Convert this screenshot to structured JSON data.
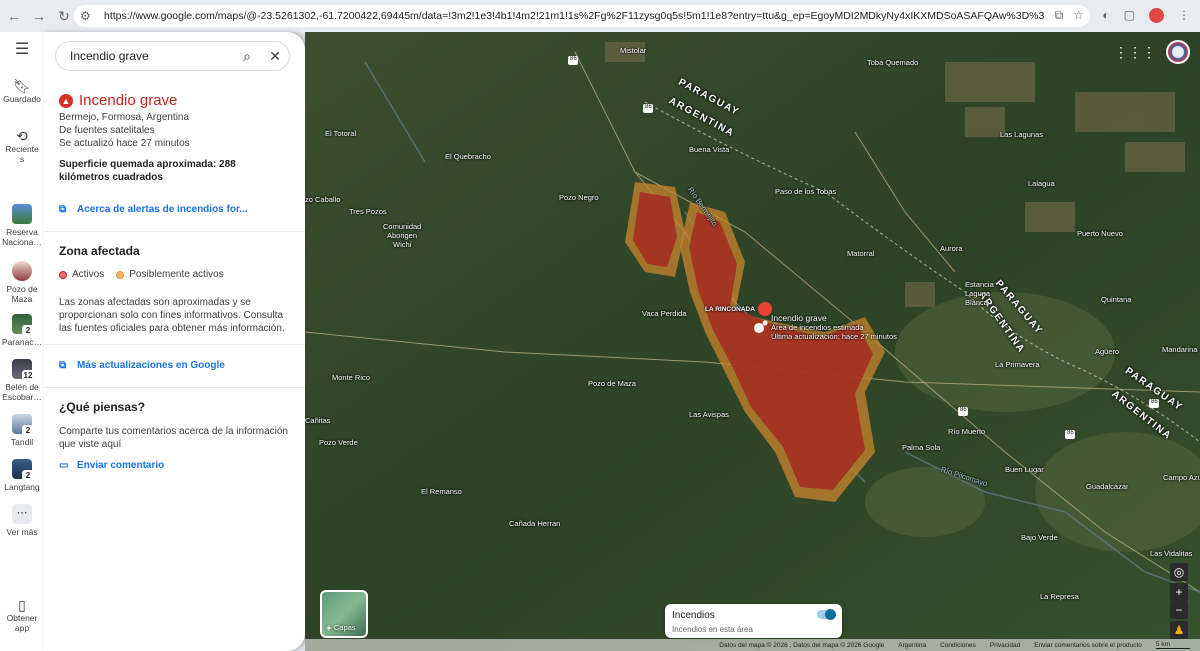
{
  "browser": {
    "url": "https://www.google.com/maps/@-23.5261302,-61.7200422,69445m/data=!3m2!1e3!4b1!4m2!21m1!1s%2Fg%2F11zysg0q5s!5m1!1e8?entry=ttu&g_ep=EgoyMDI2MDkyNy4xIKXMDSoASAFQAw%3D%3D",
    "nav_icons": [
      "back-icon",
      "forward-icon",
      "reload-icon",
      "site-settings-icon"
    ]
  },
  "rail": {
    "menu_icon": "hamburger-icon",
    "saved_label": "Guardado",
    "recent_label_1": "Reciente",
    "recent_label_2": "s",
    "items": [
      {
        "line1": "Reserva",
        "line2": "Naciona…",
        "badge": ""
      },
      {
        "line1": "Pozo de",
        "line2": "Maza",
        "badge": ""
      },
      {
        "line1": "Paranac…",
        "line2": "",
        "badge": "2"
      },
      {
        "line1": "Belén de",
        "line2": "Escobar…",
        "badge": "12"
      },
      {
        "line1": "Tandil",
        "line2": "",
        "badge": "2"
      },
      {
        "line1": "Langtang",
        "line2": "",
        "badge": "2"
      }
    ],
    "more_label": "Ver más",
    "get_app_1": "Obtener",
    "get_app_2": "app"
  },
  "panel": {
    "search_value": "Incendio grave",
    "title": "Incendio grave",
    "location": "Bermejo, Formosa, Argentina",
    "source": "De fuentes satelitales",
    "updated": "Se actualizó hace 27 minutos",
    "area_text": "Superficie quemada aproximada: 288 kilómetros cuadrados",
    "alerts_link": "Acerca de alertas de incendios for...",
    "zone_title": "Zona afectada",
    "legend_active": "Activos",
    "legend_possible": "Posiblemente activos",
    "disclaimer": "Las zonas afectadas son aproximadas y se proporcionan solo con fines informativos. Consulta las fuentes oficiales para obtener más información.",
    "more_updates_link": "Más actualizaciones en Google",
    "feedback_title": "¿Qué piensas?",
    "feedback_text": "Comparte tus comentarios acerca de la información que viste aquí",
    "feedback_link": "Enviar comentario"
  },
  "colors": {
    "fire_red": "#d93025",
    "active_dot": "#e57373",
    "possible_dot": "#f0b400",
    "link_blue": "#1a73e8"
  },
  "map": {
    "labels": {
      "mistolar": "Mistolar",
      "toba_quemado": "Toba Quemado",
      "las_lagunas": "Las Lagunas",
      "el_totoral": "El Totoral",
      "el_quebracho": "El Quebracho",
      "buena_vista": "Buena Vista",
      "lalagua": "Lalagua",
      "paso_de_los_tobas": "Paso de los Tobas",
      "pozo_negro": "Pozo Negro",
      "pozo_caballo": "zo Caballo",
      "tres_pozos": "Tres Pozos",
      "comunidad_1": "Comunidad",
      "comunidad_2": "Aborigen",
      "comunidad_3": "Wichi",
      "matorral": "Matorral",
      "aurora": "Aurora",
      "puerto_nuevo": "Puerto Nuevo",
      "estancia_1": "Estancia",
      "estancia_2": "Laguna",
      "estancia_3": "Blanca",
      "quintana": "Quintana",
      "vaca_perdida": "Vaca Perdida",
      "la_rinconada": "LA RINCONADA",
      "aguero": "Agüero",
      "mandarina": "Mandarina",
      "la_primavera": "La Primavera",
      "monte_rico": "Monte Rico",
      "pozo_de_maza": "Pozo de Maza",
      "las_avispas": "Las Avispas",
      "canitas": "Cañitas",
      "pozo_verde": "Pozo Verde",
      "palma_sola": "Palma Sola",
      "rio_muerto": "Río Muerto",
      "el_remanso": "El Remanso",
      "ben_lugar": "Buen Lugar",
      "campo_azul": "Campo Azul",
      "guadalcazar": "Guadalcázar",
      "canada_herran": "Cañada Herran",
      "bajo_verde": "Bajo Verde",
      "las_vidalitas": "Las Vidalitas",
      "la_represa": "La Represa",
      "rio_bermejito": "Río Bermejito",
      "rio_pilcomayo": "Río Pilcomayo"
    },
    "countries": {
      "paraguay": "PARAGUAY",
      "argentina": "ARGENTINA"
    },
    "route_numbers": [
      "86",
      "86",
      "86",
      "86",
      "86"
    ],
    "fire_popup": {
      "title": "Incendio grave",
      "line1": "Área de incendios estimada",
      "line2": "Última actualización: hace 27 minutos"
    },
    "layers_label": "Capas",
    "fires_card_title": "Incendios",
    "fires_card_sub": "Incendios en esta área",
    "fires_toggle_on": true,
    "attribution": [
      "Datos del mapa © 2026 , Datos del mapa © 2026 Google",
      "Argentina",
      "Condiciones",
      "Privacidad",
      "Enviar comentarios sobre el producto",
      "5 km"
    ]
  }
}
